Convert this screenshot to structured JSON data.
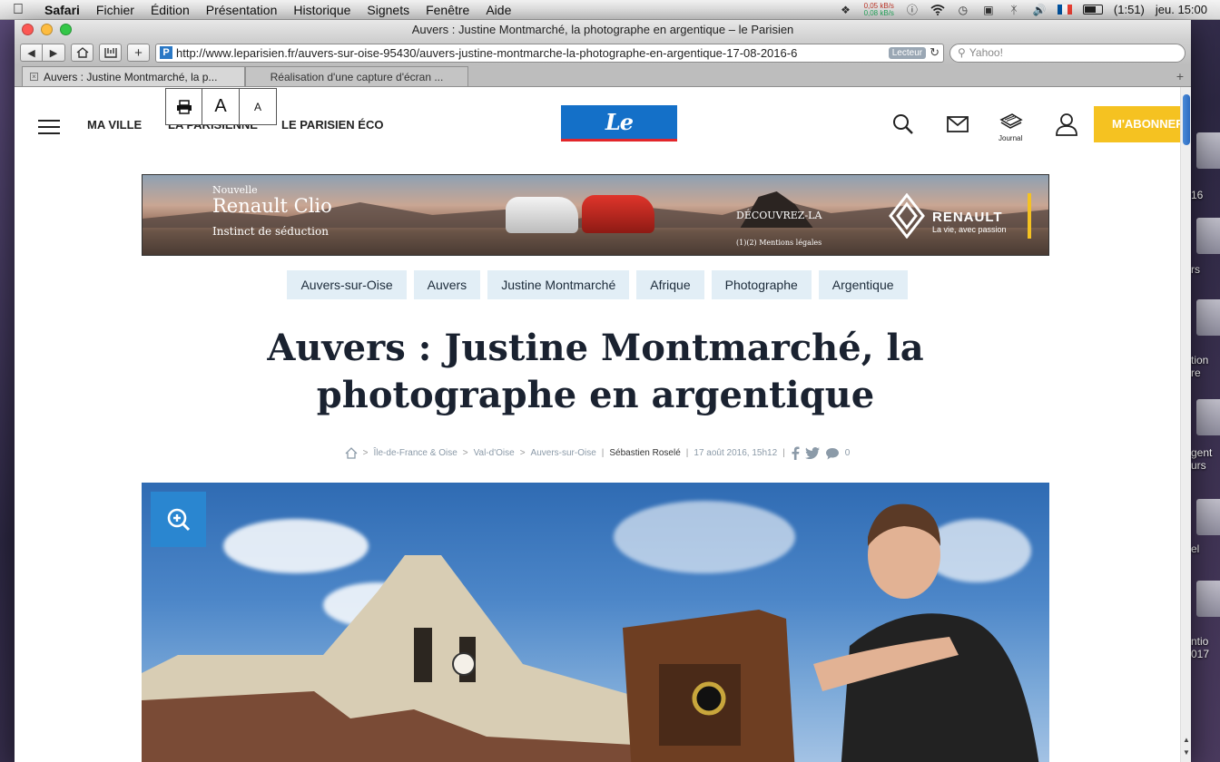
{
  "menubar": {
    "app": "Safari",
    "items": [
      "Fichier",
      "Édition",
      "Présentation",
      "Historique",
      "Signets",
      "Fenêtre",
      "Aide"
    ],
    "net_up": "0,05 kB/s",
    "net_down": "0,08 kB/s",
    "battery": "(1:51)",
    "clock": "jeu. 15:00"
  },
  "window": {
    "title": "Auvers : Justine Montmarché, la photographe en argentique – le Parisien",
    "url": "http://www.leparisien.fr/auvers-sur-oise-95430/auvers-justine-montmarche-la-photographe-en-argentique-17-08-2016-6",
    "reader_label": "Lecteur",
    "search_placeholder": "Yahoo!",
    "tabs": [
      {
        "label": "Auvers : Justine Montmarché, la p..."
      },
      {
        "label": "Réalisation d'une capture d'écran ..."
      }
    ]
  },
  "desktop": {
    "labels": [
      "16",
      "rs",
      "tion",
      "re",
      "gent",
      "urs",
      "el",
      "ntio",
      "017"
    ]
  },
  "site": {
    "nav": [
      "MA VILLE",
      "LA PARISIENNE",
      "LE PARISIEN ÉCO"
    ],
    "font_tools": {
      "big": "A",
      "small": "A"
    },
    "logo": "Le Parisien",
    "journal_label": "Journal",
    "subscribe": "M'ABONNER",
    "brand_blue": "#1470c8",
    "accent_yellow": "#f5c221"
  },
  "ad": {
    "nouvelle": "Nouvelle",
    "model": "Renault  Clio",
    "tagline": "Instinct de séduction",
    "cta": "DÉCOUVREZ-LA",
    "legal": "(1)(2) Mentions légales",
    "brand": "RENAULT",
    "slogan": "La vie, avec passion"
  },
  "article": {
    "tags": [
      "Auvers-sur-Oise",
      "Auvers",
      "Justine Montmarché",
      "Afrique",
      "Photographe",
      "Argentique"
    ],
    "headline": "Auvers : Justine Montmarché, la photographe en argentique",
    "breadcrumb": [
      "Île-de-France & Oise",
      "Val-d'Oise",
      "Auvers-sur-Oise"
    ],
    "author": "Sébastien Roselé",
    "date": "17 août 2016, 15h12",
    "comments": "0"
  }
}
